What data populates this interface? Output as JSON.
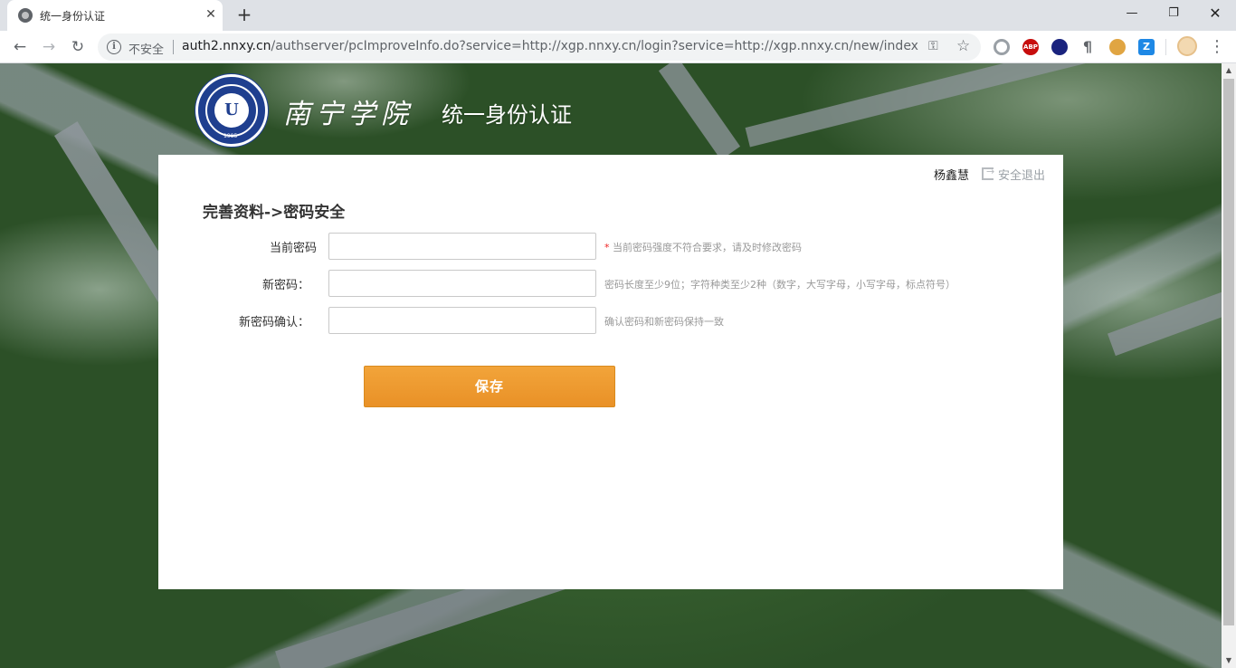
{
  "browser": {
    "tab_title": "统一身份认证",
    "tab_close": "✕",
    "new_tab": "+",
    "window_min": "—",
    "window_max": "❐",
    "window_close": "✕",
    "nav_back": "←",
    "nav_forward": "→",
    "nav_reload": "↻",
    "security_label": "不安全",
    "url_host": "auth2.nnxy.cn",
    "url_path": "/authserver/pcImproveInfo.do?service=http://xgp.nnxy.cn/login?service=http://xgp.nnxy.cn/new/index.ht...",
    "extensions": {
      "abp": "ABP",
      "z": "Z",
      "para": "¶"
    }
  },
  "header": {
    "school_name": "南宁学院",
    "system_title": "统一身份认证",
    "logo_year": "1985",
    "logo_letter": "U"
  },
  "panel": {
    "user_name": "杨鑫慧",
    "logout_label": "安全退出",
    "heading": "完善资料->密码安全",
    "fields": [
      {
        "label": "当前密码",
        "value": "",
        "hint_star": "*",
        "hint": "当前密码强度不符合要求，请及时修改密码"
      },
      {
        "label": "新密码：",
        "value": "",
        "hint_star": "",
        "hint": "密码长度至少9位；字符种类至少2种（数字，大写字母，小写字母，标点符号）"
      },
      {
        "label": "新密码确认：",
        "value": "",
        "hint_star": "",
        "hint": "确认密码和新密码保持一致"
      }
    ],
    "save_label": "保存"
  },
  "colors": {
    "brand_blue": "#1f3f8f",
    "save_button": "#f2a43a",
    "hint_text": "#999999",
    "required": "#ee2222"
  }
}
